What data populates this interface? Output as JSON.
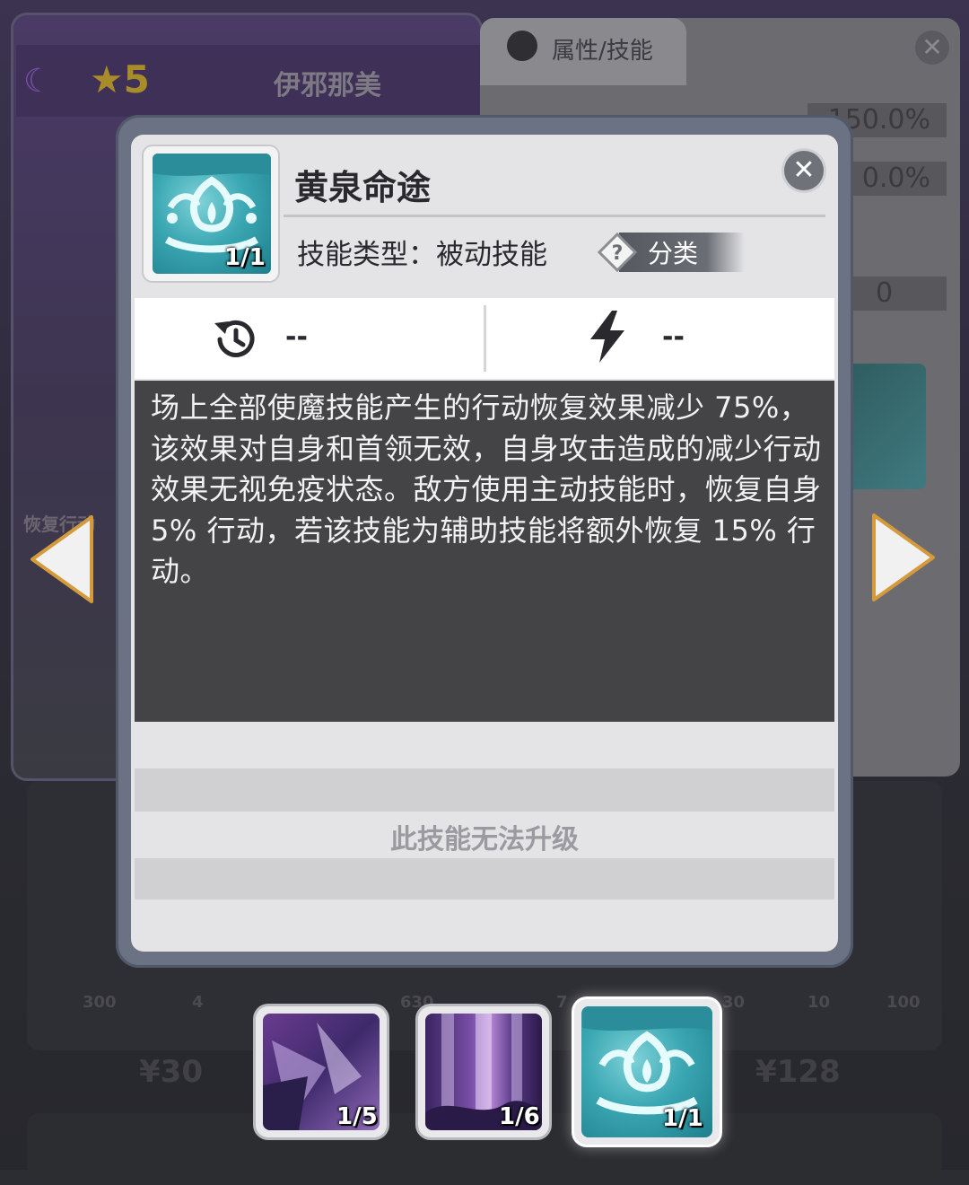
{
  "background": {
    "hero_rarity_stars": "★5",
    "hero_name": "伊邪那美",
    "panel_tab_label": "属性/技能",
    "stats": [
      "150.0%",
      "0.0%",
      "0"
    ],
    "side_label": "恢复行动",
    "item_counts": [
      "300",
      "4",
      "630",
      "7",
      "30",
      "10",
      "100"
    ],
    "prices": [
      "¥30",
      "¥128"
    ]
  },
  "skill_popup": {
    "title": "黄泉命途",
    "level": "1/1",
    "type_text": "技能类型：被动技能",
    "category_tag": "分类",
    "category_tag_icon": "?",
    "cooldown_value": "--",
    "energy_value": "--",
    "description": "场上全部使魔技能产生的行动恢复效果减少 75%，该效果对自身和首领无效，自身攻击造成的减少行动效果无视免疫状态。敌方使用主动技能时，恢复自身 5% 行动，若该技能为辅助技能将额外恢复 15% 行动。",
    "upgrade_note": "此技能无法升级",
    "close_icon": "✕"
  },
  "skill_tabs": [
    {
      "level": "1/5",
      "selected": false
    },
    {
      "level": "1/6",
      "selected": false
    },
    {
      "level": "1/1",
      "selected": true
    }
  ],
  "colors": {
    "accent_teal": "#3aa7b2",
    "desc_bg": "#444447",
    "modal_bg": "#e4e4e6"
  }
}
